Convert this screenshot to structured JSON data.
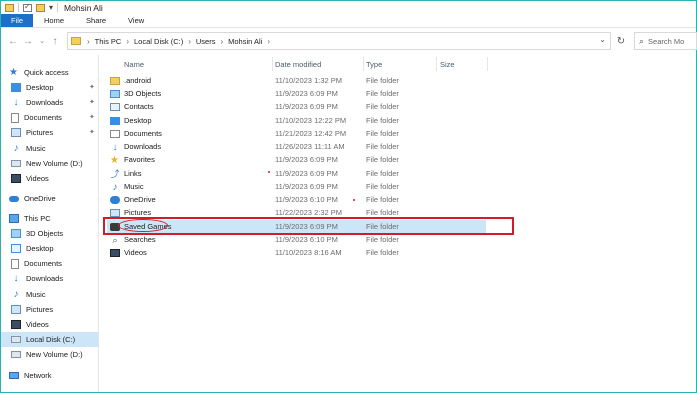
{
  "window": {
    "title": "Mohsin Ali"
  },
  "ribbon": {
    "tabs": [
      "File",
      "Home",
      "Share",
      "View"
    ]
  },
  "address": {
    "crumbs": [
      "This PC",
      "Local Disk (C:)",
      "Users",
      "Mohsin Ali"
    ]
  },
  "search": {
    "placeholder": "Search Mo"
  },
  "nav": {
    "items": [
      {
        "label": "Quick access",
        "icon": "star-icon",
        "pinned": false
      },
      {
        "label": "Desktop",
        "icon": "desktop-icon",
        "pinned": true
      },
      {
        "label": "Downloads",
        "icon": "downloads-icon",
        "pinned": true
      },
      {
        "label": "Documents",
        "icon": "documents-icon",
        "pinned": true
      },
      {
        "label": "Pictures",
        "icon": "pictures-icon",
        "pinned": true
      },
      {
        "label": "Music",
        "icon": "music-icon",
        "pinned": false
      },
      {
        "label": "New Volume (D:)",
        "icon": "drive-icon",
        "pinned": false
      },
      {
        "label": "Videos",
        "icon": "videos-icon",
        "pinned": false
      },
      {
        "label": "OneDrive",
        "icon": "onedrive-icon",
        "pinned": false
      },
      {
        "label": "This PC",
        "icon": "this-pc-icon",
        "pinned": false
      },
      {
        "label": "3D Objects",
        "icon": "3d-objects-icon",
        "pinned": false
      },
      {
        "label": "Desktop",
        "icon": "desktop-icon",
        "pinned": false
      },
      {
        "label": "Documents",
        "icon": "documents-icon",
        "pinned": false
      },
      {
        "label": "Downloads",
        "icon": "downloads-icon",
        "pinned": false
      },
      {
        "label": "Music",
        "icon": "music-icon",
        "pinned": false
      },
      {
        "label": "Pictures",
        "icon": "pictures-icon",
        "pinned": false
      },
      {
        "label": "Videos",
        "icon": "videos-icon",
        "pinned": false
      },
      {
        "label": "Local Disk (C:)",
        "icon": "drive-icon",
        "pinned": false,
        "selected": true
      },
      {
        "label": "New Volume (D:)",
        "icon": "drive-icon",
        "pinned": false
      },
      {
        "label": "Network",
        "icon": "network-icon",
        "pinned": false
      }
    ]
  },
  "columns": {
    "name": "Name",
    "date": "Date modified",
    "type": "Type",
    "size": "Size"
  },
  "files": [
    {
      "name": ".android",
      "date": "11/10/2023 1:32 PM",
      "type": "File folder",
      "icon": "folder-icon"
    },
    {
      "name": "3D Objects",
      "date": "11/9/2023 6:09 PM",
      "type": "File folder",
      "icon": "3d-objects-icon"
    },
    {
      "name": "Contacts",
      "date": "11/9/2023 6:09 PM",
      "type": "File folder",
      "icon": "contacts-icon"
    },
    {
      "name": "Desktop",
      "date": "11/10/2023 12:22 PM",
      "type": "File folder",
      "icon": "desktop-icon"
    },
    {
      "name": "Documents",
      "date": "11/21/2023 12:42 PM",
      "type": "File folder",
      "icon": "documents-icon"
    },
    {
      "name": "Downloads",
      "date": "11/26/2023 11:11 AM",
      "type": "File folder",
      "icon": "downloads-icon"
    },
    {
      "name": "Favorites",
      "date": "11/9/2023 6:09 PM",
      "type": "File folder",
      "icon": "star-icon"
    },
    {
      "name": "Links",
      "date": "11/9/2023 6:09 PM",
      "type": "File folder",
      "icon": "links-icon"
    },
    {
      "name": "Music",
      "date": "11/9/2023 6:09 PM",
      "type": "File folder",
      "icon": "music-icon"
    },
    {
      "name": "OneDrive",
      "date": "11/9/2023 6:10 PM",
      "type": "File folder",
      "icon": "onedrive-icon"
    },
    {
      "name": "Pictures",
      "date": "11/22/2023 2:32 PM",
      "type": "File folder",
      "icon": "pictures-icon"
    },
    {
      "name": "Saved Games",
      "date": "11/9/2023 6:09 PM",
      "type": "File folder",
      "icon": "saved-games-icon",
      "selected": true
    },
    {
      "name": "Searches",
      "date": "11/9/2023 6:10 PM",
      "type": "File folder",
      "icon": "search-icon"
    },
    {
      "name": "Videos",
      "date": "11/10/2023 8:16 AM",
      "type": "File folder",
      "icon": "videos-icon"
    }
  ],
  "colors": {
    "file_tab": "#1e6fc7",
    "selection": "#cce6f7",
    "annotation": "#d11d2a"
  }
}
